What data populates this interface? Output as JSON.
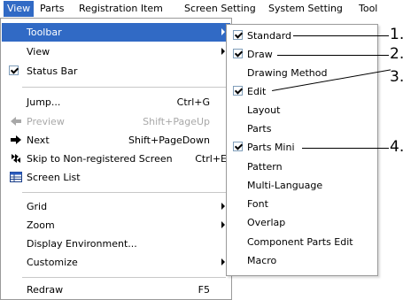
{
  "menubar": {
    "items": [
      "View",
      "Parts",
      "Registration Item",
      "Screen Setting",
      "System Setting",
      "Tool"
    ]
  },
  "view_menu": {
    "toolbar": "Toolbar",
    "view": "View",
    "status_bar": "Status Bar",
    "jump": "Jump...",
    "jump_shortcut": "Ctrl+G",
    "preview": "Preview",
    "preview_shortcut": "Shift+PageUp",
    "next": "Next",
    "next_shortcut": "Shift+PageDown",
    "skip": "Skip to Non-registered Screen",
    "skip_shortcut": "Ctrl+E",
    "screen_list": "Screen List",
    "grid": "Grid",
    "zoom": "Zoom",
    "display_environment": "Display Environment...",
    "customize": "Customize",
    "redraw": "Redraw",
    "redraw_shortcut": "F5"
  },
  "toolbar_submenu": {
    "items": [
      {
        "label": "Standard",
        "checked": true
      },
      {
        "label": "Draw",
        "checked": true
      },
      {
        "label": "Drawing Method",
        "checked": false
      },
      {
        "label": "Edit",
        "checked": true
      },
      {
        "label": "Layout",
        "checked": false
      },
      {
        "label": "Parts",
        "checked": false
      },
      {
        "label": "Parts Mini",
        "checked": true
      },
      {
        "label": "Pattern",
        "checked": false
      },
      {
        "label": "Multi-Language",
        "checked": false
      },
      {
        "label": "Font",
        "checked": false
      },
      {
        "label": "Overlap",
        "checked": false
      },
      {
        "label": "Component Parts Edit",
        "checked": false
      },
      {
        "label": "Macro",
        "checked": false
      }
    ]
  },
  "callouts": [
    "1.",
    "2.",
    "3.",
    "4."
  ],
  "colors": {
    "highlight": "#316ac5",
    "disabled": "#a8a8a8"
  }
}
